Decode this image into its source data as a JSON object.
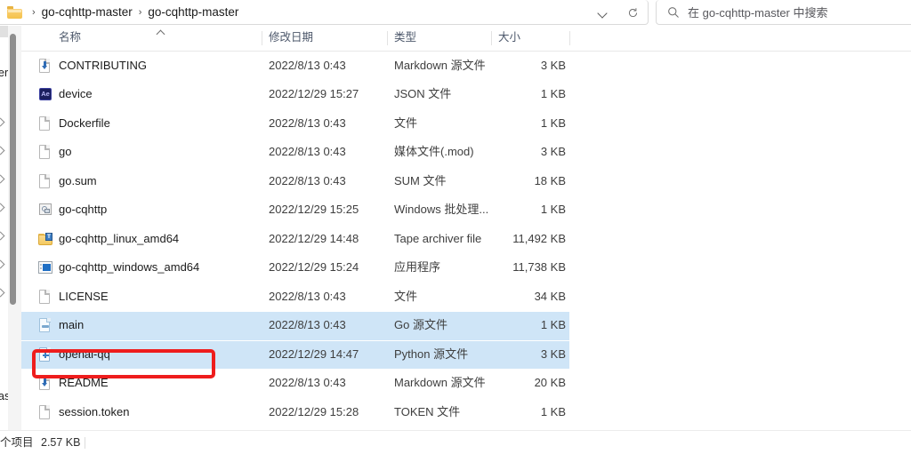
{
  "window": {
    "app": "File Explorer",
    "accent_selection": "#cfe5f7",
    "annotation_color": "#ee1d1d"
  },
  "address_bar": {
    "folder_icon": "folder-icon",
    "separator": "›",
    "crumbs": [
      "go-cqhttp-master",
      "go-cqhttp-master"
    ],
    "history_dropdown_icon": "chevron-down-icon",
    "refresh_icon": "refresh-icon"
  },
  "search": {
    "icon": "search-icon",
    "placeholder": "在 go-cqhttp-master 中搜索"
  },
  "nav_pane": {
    "clipped_labels": [
      "er",
      "as"
    ],
    "expander_icon": "chevron-right-icon"
  },
  "scrollbar": {
    "orientation": "vertical",
    "thumb": "scrollbar-thumb"
  },
  "columns": [
    {
      "key": "name",
      "label": "名称",
      "sorted": "ascending",
      "sort_icon": "caret-up-icon"
    },
    {
      "key": "date",
      "label": "修改日期"
    },
    {
      "key": "type",
      "label": "类型"
    },
    {
      "key": "size",
      "label": "大小"
    }
  ],
  "files": [
    {
      "name": "CONTRIBUTING",
      "date": "2022/8/13 0:43",
      "type": "Markdown 源文件",
      "size": "3 KB",
      "icon": "markdown-file-icon",
      "selected": false
    },
    {
      "name": "device",
      "date": "2022/12/29 15:27",
      "type": "JSON 文件",
      "size": "1 KB",
      "icon": "json-ae-file-icon",
      "selected": false
    },
    {
      "name": "Dockerfile",
      "date": "2022/8/13 0:43",
      "type": "文件",
      "size": "1 KB",
      "icon": "generic-file-icon",
      "selected": false
    },
    {
      "name": "go",
      "date": "2022/8/13 0:43",
      "type": "媒体文件(.mod)",
      "size": "3 KB",
      "icon": "generic-file-icon",
      "selected": false
    },
    {
      "name": "go.sum",
      "date": "2022/8/13 0:43",
      "type": "SUM 文件",
      "size": "18 KB",
      "icon": "generic-file-icon",
      "selected": false
    },
    {
      "name": "go-cqhttp",
      "date": "2022/12/29 15:25",
      "type": "Windows 批处理...",
      "size": "1 KB",
      "icon": "batch-file-icon",
      "selected": false
    },
    {
      "name": "go-cqhttp_linux_amd64",
      "date": "2022/12/29 14:48",
      "type": "Tape archiver file",
      "size": "11,492 KB",
      "icon": "tar-archive-icon",
      "selected": false
    },
    {
      "name": "go-cqhttp_windows_amd64",
      "date": "2022/12/29 15:24",
      "type": "应用程序",
      "size": "11,738 KB",
      "icon": "application-exe-icon",
      "selected": false
    },
    {
      "name": "LICENSE",
      "date": "2022/8/13 0:43",
      "type": "文件",
      "size": "34 KB",
      "icon": "generic-file-icon",
      "selected": false
    },
    {
      "name": "main",
      "date": "2022/8/13 0:43",
      "type": "Go 源文件",
      "size": "1 KB",
      "icon": "go-source-file-icon",
      "selected": true
    },
    {
      "name": "openai-qq",
      "date": "2022/12/29 14:47",
      "type": "Python 源文件",
      "size": "3 KB",
      "icon": "python-source-file-icon",
      "selected": true,
      "annotated": true
    },
    {
      "name": "README",
      "date": "2022/8/13 0:43",
      "type": "Markdown 源文件",
      "size": "20 KB",
      "icon": "markdown-file-icon",
      "selected": false
    },
    {
      "name": "session.token",
      "date": "2022/12/29 15:28",
      "type": "TOKEN 文件",
      "size": "1 KB",
      "icon": "generic-file-icon",
      "selected": false
    }
  ],
  "status_bar": {
    "items_text": "个项目",
    "size_text": "2.57 KB"
  }
}
